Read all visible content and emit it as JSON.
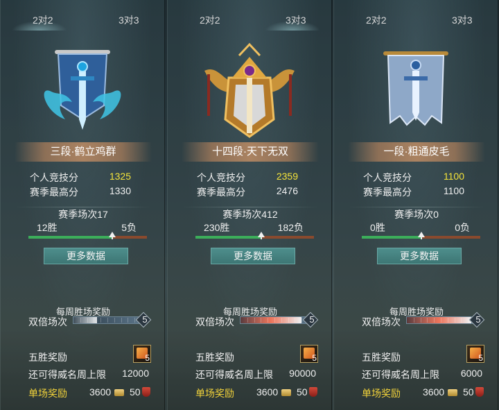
{
  "panels": [
    {
      "tab_2v2": "2对2",
      "tab_3v3": "3对3",
      "active_tab": "2v2",
      "rank_title": "三段·鹤立鸡群",
      "emblem": "blue-dragon-banner-icon",
      "personal_score_label": "个人竞技分",
      "personal_score": "1325",
      "season_high_label": "赛季最高分",
      "season_high": "1330",
      "season_matches": "赛季场次17",
      "wins": "12胜",
      "losses": "5负",
      "win_ratio": 0.706,
      "more_data": "更多数据",
      "weekly_title": "每周胜场奖励",
      "double_label": "双倍场次",
      "double_count": "5",
      "double_fill": 0.35,
      "five_win_label": "五胜奖励",
      "five_win_icon_count": "5",
      "fame_cap_label": "还可得威名周上限",
      "fame_cap": "12000",
      "single_reward_label": "单场奖励",
      "single_reward_coins": "3600",
      "single_reward_honor": "50"
    },
    {
      "tab_2v2": "2对2",
      "tab_3v3": "3对3",
      "active_tab": "3v3",
      "rank_title": "十四段·天下无双",
      "emblem": "golden-sword-crest-icon",
      "personal_score_label": "个人竞技分",
      "personal_score": "2359",
      "season_high_label": "赛季最高分",
      "season_high": "2476",
      "season_matches": "赛季场次412",
      "wins": "230胜",
      "losses": "182负",
      "win_ratio": 0.558,
      "more_data": "更多数据",
      "weekly_title": "每周胜场奖励",
      "double_label": "双倍场次",
      "double_count": "5",
      "double_fill": 0.9,
      "five_win_label": "五胜奖励",
      "five_win_icon_count": "5",
      "fame_cap_label": "还可得威名周上限",
      "fame_cap": "90000",
      "single_reward_label": "单场奖励",
      "single_reward_coins": "3600",
      "single_reward_honor": "50"
    },
    {
      "tab_2v2": "2对2",
      "tab_3v3": "3对3",
      "active_tab": "none",
      "rank_title": "一段·粗通皮毛",
      "emblem": "plain-sword-banner-icon",
      "personal_score_label": "个人竞技分",
      "personal_score": "1100",
      "season_high_label": "赛季最高分",
      "season_high": "1100",
      "season_matches": "赛季场次0",
      "wins": "0胜",
      "losses": "0负",
      "win_ratio": 0.5,
      "more_data": "更多数据",
      "weekly_title": "每周胜场奖励",
      "double_label": "双倍场次",
      "double_count": "5",
      "double_fill": 0.95,
      "five_win_label": "五胜奖励",
      "five_win_icon_count": "5",
      "fame_cap_label": "还可得威名周上限",
      "fame_cap": "6000",
      "single_reward_label": "单场奖励",
      "single_reward_coins": "3600",
      "single_reward_honor": "50"
    }
  ],
  "colors": {
    "score_highlight": "#f5e43a",
    "single_reward": "#f1d23a",
    "win_bar": "#3cae5a",
    "loss_bar": "#8a4a2e",
    "button": "#4e8e8c"
  }
}
